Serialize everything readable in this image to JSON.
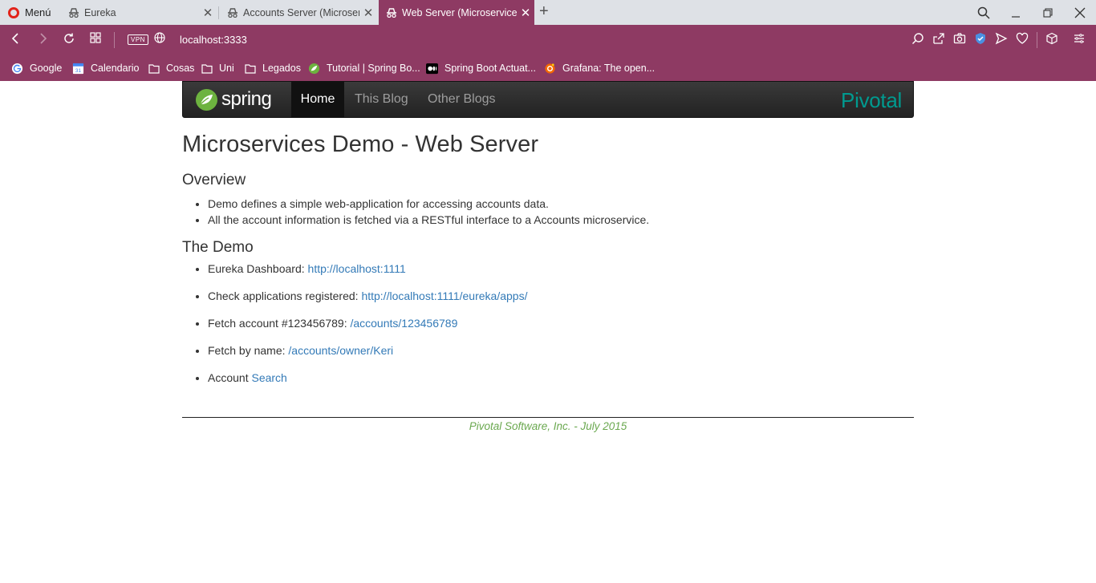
{
  "browser": {
    "menu_label": "Menú",
    "tabs": [
      {
        "title": "Eureka"
      },
      {
        "title": "Accounts Server (Microservices"
      },
      {
        "title": "Web Server (Microservices Demo)"
      }
    ],
    "url": "localhost:3333",
    "vpn_label": "VPN",
    "bookmarks": [
      {
        "label": "Google"
      },
      {
        "label": "Calendario"
      },
      {
        "label": "Cosas"
      },
      {
        "label": "Uni"
      },
      {
        "label": "Legados"
      },
      {
        "label": "Tutorial | Spring Bo..."
      },
      {
        "label": "Spring Boot Actuat..."
      },
      {
        "label": "Grafana: The open..."
      }
    ],
    "colors": {
      "theme": "#8e3a63",
      "tabbar": "#dee1e6"
    }
  },
  "navbar": {
    "logo_text": "spring",
    "items": [
      {
        "label": "Home",
        "active": true
      },
      {
        "label": "This Blog"
      },
      {
        "label": "Other Blogs"
      }
    ],
    "brand_right": "Pivotal"
  },
  "content": {
    "title": "Microservices Demo - Web Server",
    "overview_heading": "Overview",
    "overview_items": [
      "Demo defines a simple web-application for accessing accounts data.",
      "All the account information is fetched via a RESTful interface to a Accounts microservice."
    ],
    "demo_heading": "The Demo",
    "demo_items": [
      {
        "text": "Eureka Dashboard: ",
        "link": "http://localhost:1111"
      },
      {
        "text": "Check applications registered: ",
        "link": "http://localhost:1111/eureka/apps/"
      },
      {
        "text": "Fetch account #123456789: ",
        "link": "/accounts/123456789"
      },
      {
        "text": "Fetch by name: ",
        "link": "/accounts/owner/Keri"
      },
      {
        "text": "Account ",
        "link": "Search"
      }
    ],
    "footer": "Pivotal Software, Inc. - July 2015"
  }
}
